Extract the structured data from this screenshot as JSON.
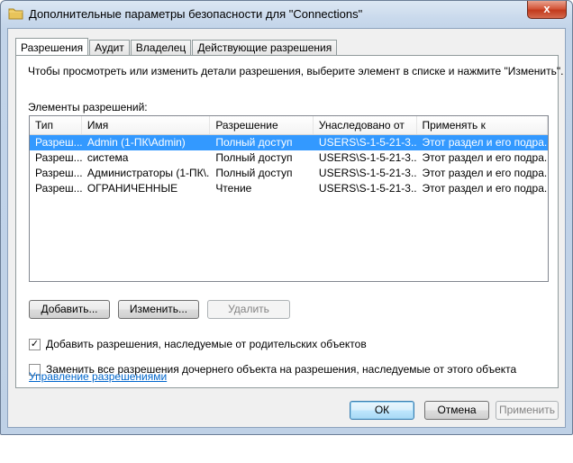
{
  "window": {
    "title": "Дополнительные параметры безопасности  для \"Connections\"",
    "close_glyph": "x"
  },
  "tabs": [
    {
      "label": "Разрешения"
    },
    {
      "label": "Аудит"
    },
    {
      "label": "Владелец"
    },
    {
      "label": "Действующие разрешения"
    }
  ],
  "panel": {
    "instructions": "Чтобы просмотреть или изменить детали разрешения, выберите элемент в списке и нажмите \"Изменить\".",
    "list_label": "Элементы разрешений:"
  },
  "table": {
    "columns": [
      "Тип",
      "Имя",
      "Разрешение",
      "Унаследовано от",
      "Применять к"
    ],
    "rows": [
      [
        "Разреш...",
        "Admin (1-ПК\\Admin)",
        "Полный доступ",
        "USERS\\S-1-5-21-3...",
        "Этот раздел и его подра..."
      ],
      [
        "Разреш...",
        "система",
        "Полный доступ",
        "USERS\\S-1-5-21-3...",
        "Этот раздел и его подра..."
      ],
      [
        "Разреш...",
        "Администраторы (1-ПК\\...",
        "Полный доступ",
        "USERS\\S-1-5-21-3...",
        "Этот раздел и его подра..."
      ],
      [
        "Разреш...",
        "ОГРАНИЧЕННЫЕ",
        "Чтение",
        "USERS\\S-1-5-21-3...",
        "Этот раздел и его подра..."
      ]
    ]
  },
  "buttons": {
    "add": "Добавить...",
    "edit": "Изменить...",
    "remove": "Удалить",
    "ok": "ОК",
    "cancel": "Отмена",
    "apply": "Применить"
  },
  "checkboxes": {
    "inherit": {
      "label": "Добавить разрешения, наследуемые от родительских объектов",
      "checked": true,
      "glyph": "✓"
    },
    "replace": {
      "label": "Заменить все разрешения дочернего объекта на разрешения, наследуемые от этого объекта",
      "checked": false
    }
  },
  "link": {
    "label": "Управление разрешениями"
  },
  "colors": {
    "selection": "#3399ff",
    "link": "#0066cc",
    "close": "#c23a1c"
  }
}
